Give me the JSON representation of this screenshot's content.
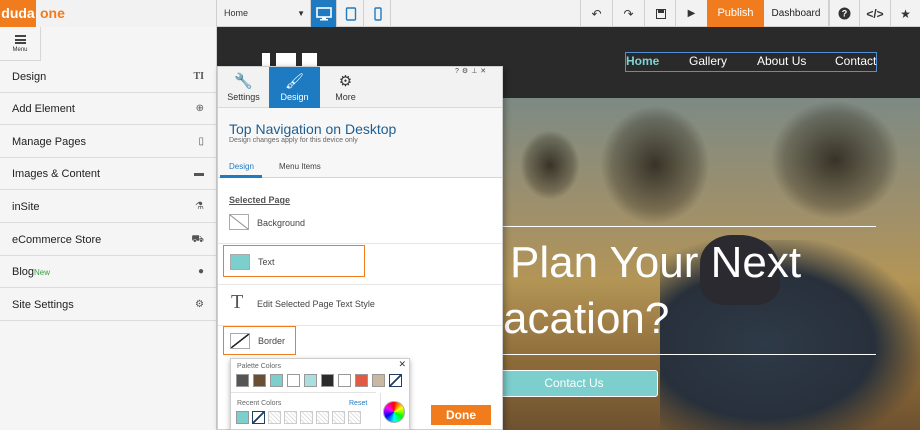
{
  "app": {
    "brand_prefix": "duda",
    "brand_suffix": "one"
  },
  "toolbar": {
    "page_select": "Home",
    "publish_label": "Publish",
    "dashboard_label": "Dashboard"
  },
  "sidebar": {
    "menu_label": "Menu",
    "items": [
      {
        "label": "Design",
        "icon": "typography-icon"
      },
      {
        "label": "Add Element",
        "icon": "plus-circle-icon"
      },
      {
        "label": "Manage Pages",
        "icon": "page-icon"
      },
      {
        "label": "Images & Content",
        "icon": "briefcase-icon"
      },
      {
        "label": "inSite",
        "icon": "flask-icon"
      },
      {
        "label": "eCommerce Store",
        "icon": "cart-icon"
      },
      {
        "label": "Blog",
        "badge": "New",
        "icon": "chat-icon"
      },
      {
        "label": "Site Settings",
        "icon": "gear-icon"
      }
    ]
  },
  "site": {
    "nav": [
      "Home",
      "Gallery",
      "About Us",
      "Contact"
    ],
    "hero_line1": "Plan Your Next",
    "hero_line2": "acation?",
    "cta": "Contact Us"
  },
  "panel": {
    "tabs": [
      "Settings",
      "Design",
      "More"
    ],
    "title": "Top Navigation on Desktop",
    "subtitle": "Design changes apply for this device only",
    "subtabs": [
      "Design",
      "Menu Items"
    ],
    "section": "Selected Page",
    "rows": [
      "Background",
      "Text",
      "Edit Selected Page Text Style",
      "Border"
    ],
    "done": "Done",
    "text_color": "#7ccfcd"
  },
  "color_picker": {
    "palette_label": "Palette Colors",
    "recent_label": "Recent Colors",
    "reset_label": "Reset",
    "palette": [
      "#555555",
      "#6b4f33",
      "#7ccfcd",
      "#ffffff",
      "#a9e0df",
      "#2b2b2b",
      "#ffffff",
      "#e05a44",
      "#c9b9a3",
      "none"
    ],
    "recent": [
      "#7ccfcd",
      "none",
      "empty",
      "empty",
      "empty",
      "empty",
      "empty",
      "empty"
    ]
  }
}
